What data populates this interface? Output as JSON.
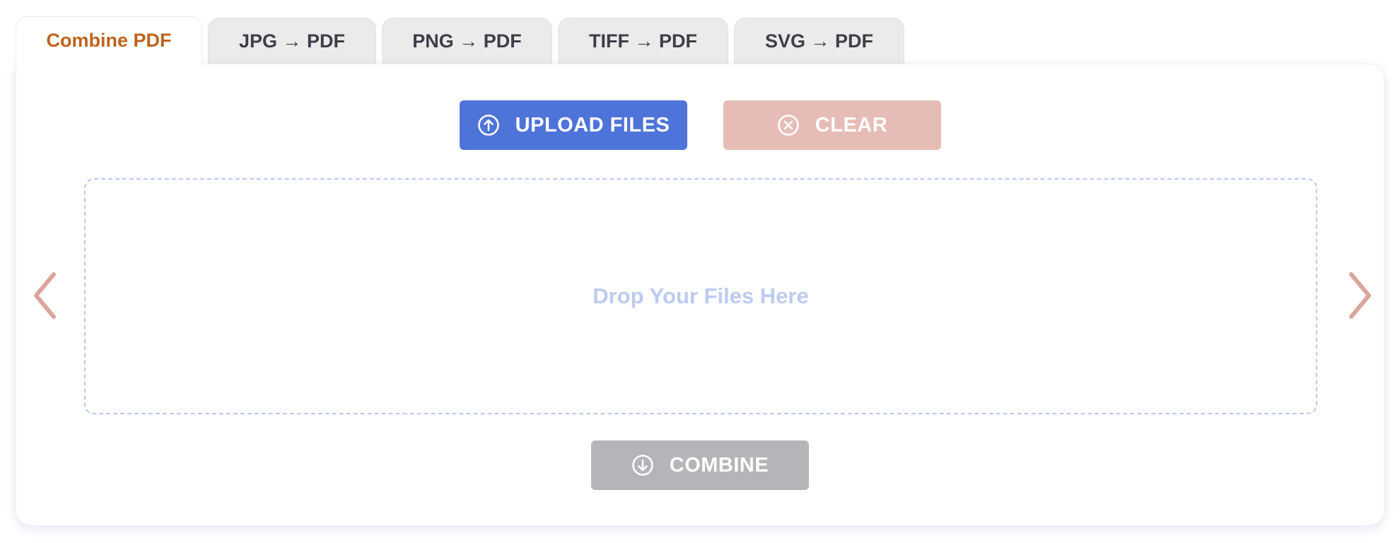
{
  "tabs": [
    {
      "label": "Combine PDF",
      "active": true
    },
    {
      "label": "JPG → PDF",
      "active": false
    },
    {
      "label": "PNG → PDF",
      "active": false
    },
    {
      "label": "TIFF → PDF",
      "active": false
    },
    {
      "label": "SVG → PDF",
      "active": false
    }
  ],
  "toolbar": {
    "upload_label": "UPLOAD FILES",
    "clear_label": "CLEAR"
  },
  "dropzone": {
    "text": "Drop Your Files Here"
  },
  "actions": {
    "combine_label": "COMBINE"
  },
  "icons": {
    "upload": "arrow-up-circle-icon",
    "clear": "x-circle-icon",
    "combine": "arrow-down-circle-icon",
    "prev": "chevron-left-icon",
    "next": "chevron-right-icon"
  },
  "colors": {
    "active_tab_text": "#c0631f",
    "tab_text": "#3c3f48",
    "upload_button": "#4e73d9",
    "clear_button": "#e6bdb6",
    "combine_button": "#b4b5b8",
    "dropzone_border": "#b9c8f0",
    "arrow": "#dba59c"
  }
}
